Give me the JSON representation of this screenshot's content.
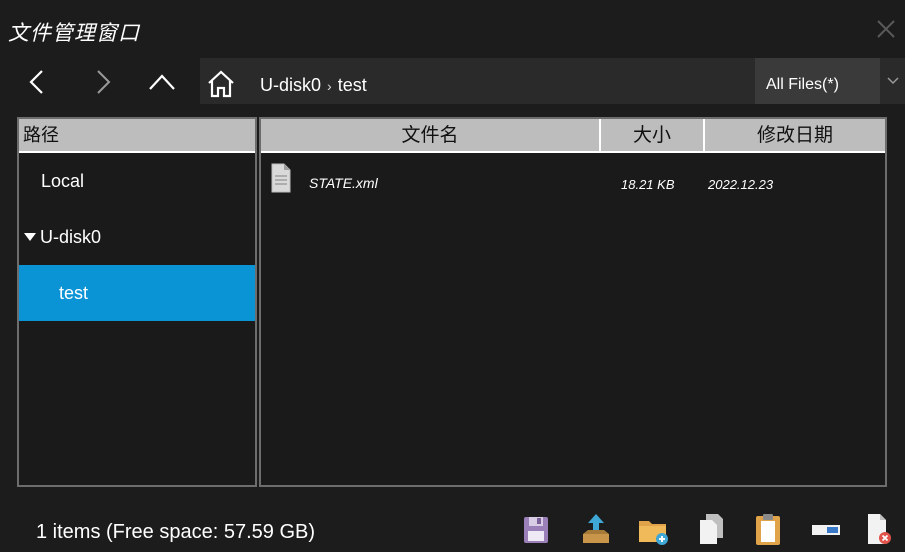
{
  "window": {
    "title": "文件管理窗口"
  },
  "nav": {
    "back_icon": "chevron-left-icon",
    "forward_icon": "chevron-right-icon",
    "up_icon": "chevron-up-icon",
    "home_icon": "home-icon",
    "breadcrumb": [
      "U-disk0",
      "test"
    ],
    "breadcrumb_separator": "›",
    "filter": "All Files(*)"
  },
  "tree": {
    "header": "路径",
    "items": [
      {
        "label": "Local",
        "expanded": false,
        "selected": false
      },
      {
        "label": "U-disk0",
        "expanded": true,
        "selected": false
      },
      {
        "label": "test",
        "expanded": false,
        "selected": true
      }
    ]
  },
  "files": {
    "columns": [
      "文件名",
      "大小",
      "修改日期"
    ],
    "rows": [
      {
        "name": "STATE.xml",
        "size": "18.21 KB",
        "date": "2022.12.23",
        "icon": "document-icon"
      }
    ]
  },
  "status": {
    "text": "1 items (Free space: 57.59 GB)"
  },
  "toolbar": {
    "icons": [
      "save-icon",
      "upload-icon",
      "new-folder-icon",
      "copy-icon",
      "paste-icon",
      "rename-icon",
      "delete-icon"
    ]
  },
  "colors": {
    "selection": "#0a94d6",
    "header_bg": "#bdbdbd",
    "background": "#1c1c1c"
  }
}
